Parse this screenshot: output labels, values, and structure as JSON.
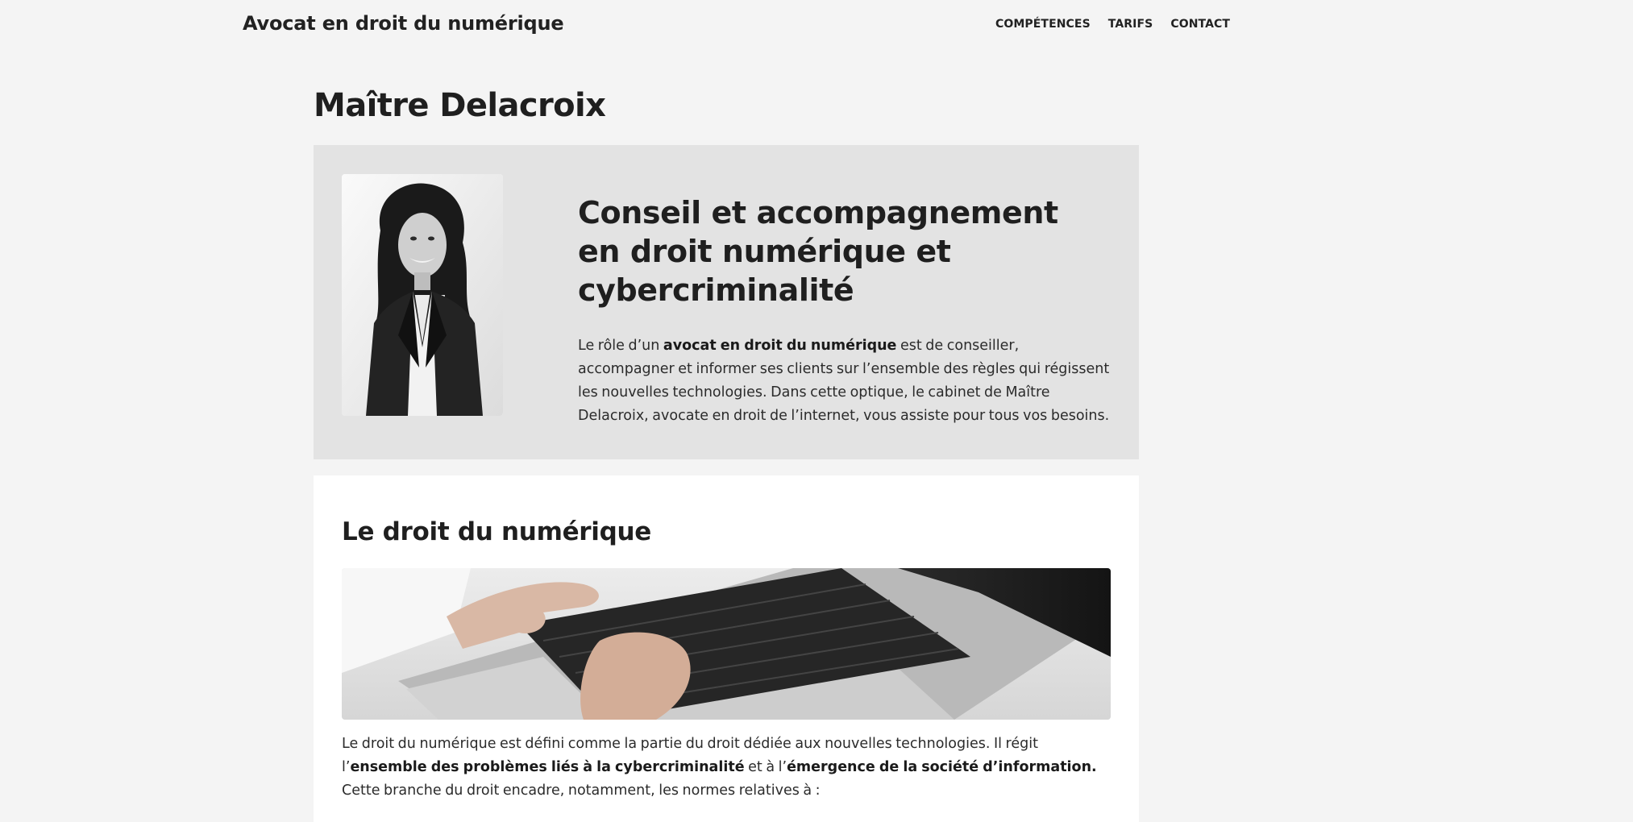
{
  "header": {
    "site_title": "Avocat en droit du numérique",
    "nav": [
      {
        "label": "COMPÉTENCES"
      },
      {
        "label": "TARIFS"
      },
      {
        "label": "CONTACT"
      }
    ]
  },
  "page": {
    "title": "Maître Delacroix"
  },
  "hero": {
    "portrait_alt": "Portrait de Maître Delacroix",
    "heading": "Conseil et accompagnement en droit numérique et cybercriminalité",
    "text": {
      "before": "Le rôle d’un ",
      "bold": "avocat en droit du numérique",
      "after": " est de conseiller, accompagner et informer ses clients sur l’ensemble des règles qui régissent les nouvelles technologies. Dans cette optique, le cabinet de Maître Delacroix, avocate en droit de l’internet, vous assiste pour tous vos besoins."
    }
  },
  "section": {
    "heading": "Le droit du numérique",
    "image_alt": "Mains tapant sur le clavier d'un ordinateur portable",
    "text": {
      "part1": "Le droit du numérique est défini comme la partie du droit dédiée aux nouvelles technologies. Il régit l’",
      "bold1": "ensemble des problèmes liés à la cybercriminalité",
      "part2": " et à l’",
      "bold2": "émergence de la société d’information.",
      "part3": " Cette branche du droit encadre, notamment, les normes relatives à :"
    }
  },
  "colors": {
    "page_background": "#f4f4f4",
    "hero_background": "#e3e3e3",
    "card_background": "#ffffff",
    "text": "#1f1f1f"
  }
}
